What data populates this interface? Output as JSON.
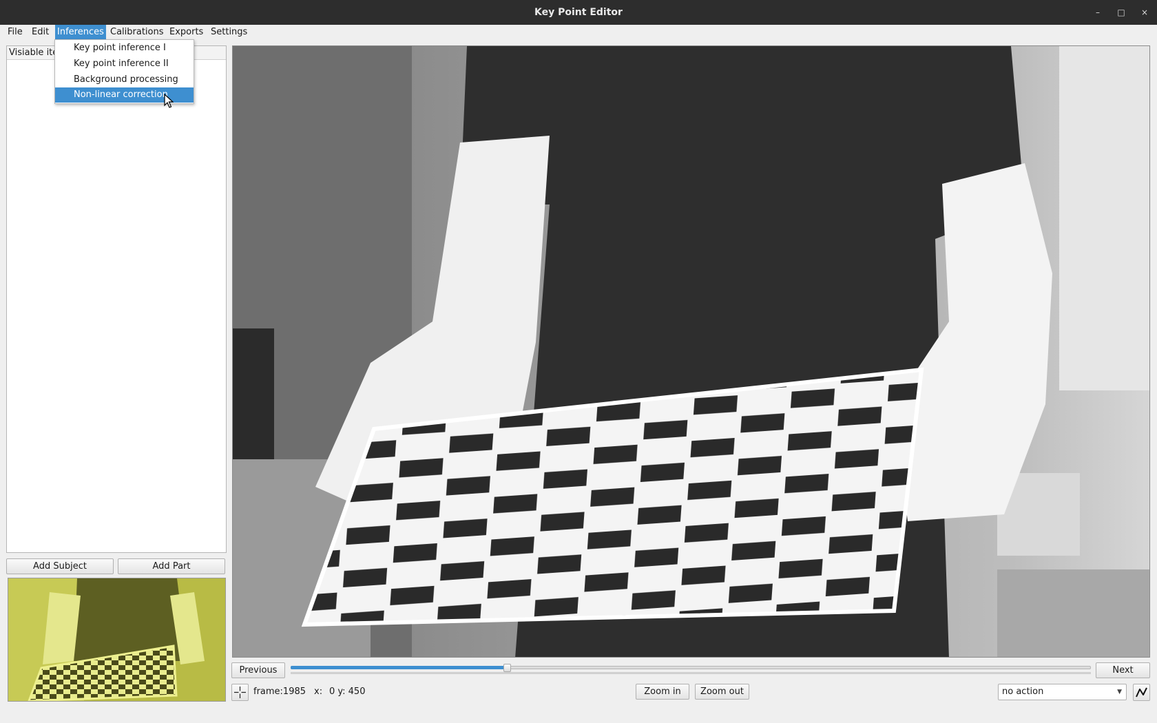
{
  "window": {
    "title": "Key Point Editor",
    "minimize_glyph": "–",
    "maximize_glyph": "□",
    "close_glyph": "×"
  },
  "menubar": {
    "items": [
      "File",
      "Edit",
      "Inferences",
      "Calibrations",
      "Exports",
      "Settings"
    ],
    "active": "Inferences"
  },
  "inferences_menu": {
    "items": [
      "Key point inference I",
      "Key point inference II",
      "Background processing",
      "Non-linear correction"
    ],
    "highlighted": "Non-linear correction"
  },
  "left_panel": {
    "header": "Visiable items",
    "add_subject_label": "Add Subject",
    "add_part_label": "Add Part"
  },
  "viewer": {
    "previous_label": "Previous",
    "next_label": "Next",
    "frame_slider_position": 0.27
  },
  "status": {
    "frame_text": "frame:1985",
    "x_text": "x:",
    "xy_value_text": "0 y: 450",
    "zoom_in_label": "Zoom in",
    "zoom_out_label": "Zoom out",
    "action_select_value": "no action"
  },
  "icons": {
    "crosshair": "crosshair-icon",
    "curve": "curve-icon",
    "pointer": "mouse-pointer-icon"
  },
  "colors": {
    "accent": "#3e8fd0",
    "titlebar": "#2d2d2d",
    "thumbnail_tint": "#d8dc5a"
  }
}
